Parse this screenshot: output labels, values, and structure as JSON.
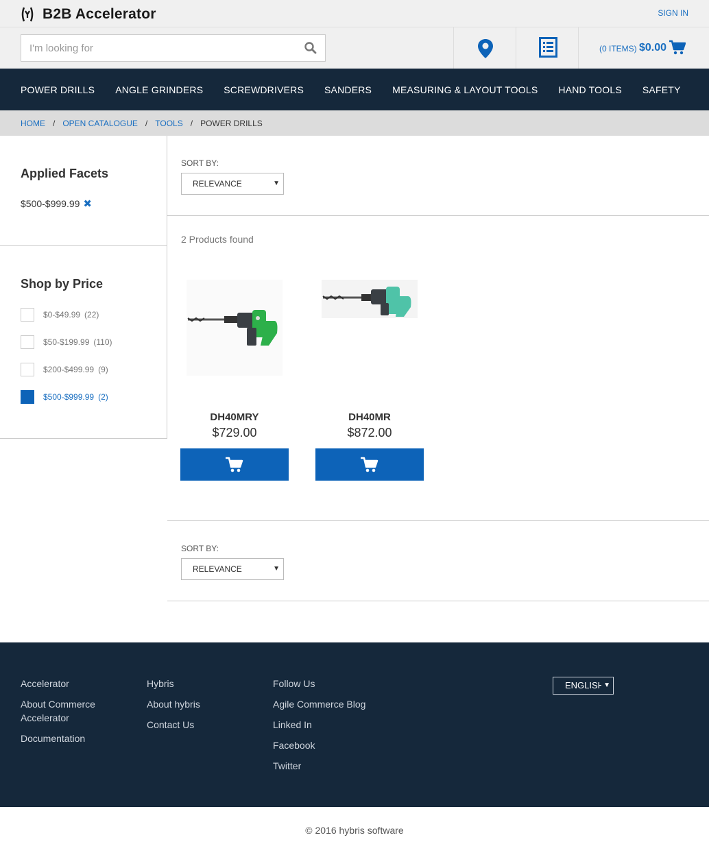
{
  "header": {
    "brand": "B2B Accelerator",
    "sign_in": "SIGN IN",
    "search_placeholder": "I'm looking for",
    "cart_count": "(0 ITEMS)",
    "cart_total": "$0.00"
  },
  "nav": [
    "POWER DRILLS",
    "ANGLE GRINDERS",
    "SCREWDRIVERS",
    "SANDERS",
    "MEASURING & LAYOUT TOOLS",
    "HAND TOOLS",
    "SAFETY"
  ],
  "breadcrumb": {
    "home": "HOME",
    "catalogue": "OPEN CATALOGUE",
    "tools": "TOOLS",
    "current": "POWER DRILLS",
    "separator": "/"
  },
  "facets": {
    "applied_title": "Applied Facets",
    "applied_value": "$500-$999.99",
    "applied_remove": "✖",
    "price_title": "Shop by Price",
    "price_items": [
      {
        "label": "$0-$49.99",
        "count": "(22)",
        "checked": false
      },
      {
        "label": "$50-$199.99",
        "count": "(110)",
        "checked": false
      },
      {
        "label": "$200-$499.99",
        "count": "(9)",
        "checked": false
      },
      {
        "label": "$500-$999.99",
        "count": "(2)",
        "checked": true
      }
    ]
  },
  "sort": {
    "label": "SORT BY:",
    "value": "RELEVANCE"
  },
  "results": {
    "found_text": "2 Products found",
    "products": [
      {
        "name": "DH40MRY",
        "price": "$729.00"
      },
      {
        "name": "DH40MR",
        "price": "$872.00"
      }
    ]
  },
  "footer": {
    "col1": [
      "Accelerator",
      "About Commerce Accelerator",
      "Documentation"
    ],
    "col2": [
      "Hybris",
      "About hybris",
      "Contact Us"
    ],
    "col3": [
      "Follow Us",
      "Agile Commerce Blog",
      "Linked In",
      "Facebook",
      "Twitter"
    ],
    "language": "ENGLISH",
    "copyright": "© 2016 hybris software"
  },
  "colors": {
    "accent": "#0d63b8",
    "nav_bg": "#15283b",
    "link": "#1a6fc1"
  }
}
